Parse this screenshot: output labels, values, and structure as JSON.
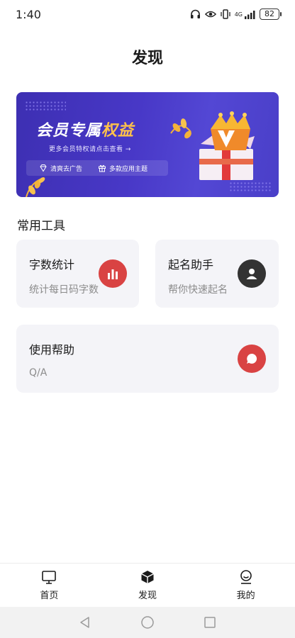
{
  "status": {
    "time": "1:40",
    "network": "4G",
    "battery": "82"
  },
  "page": {
    "title": "发现"
  },
  "banner": {
    "title_main": "会员专属",
    "title_accent": "权益",
    "subtitle": "更多会员特权请点击查看 →",
    "perks": [
      "清爽去广告",
      "多款应用主题"
    ],
    "colors": {
      "background": "#4838c7",
      "accent": "#ffc24a"
    }
  },
  "tools": {
    "section_title": "常用工具",
    "cards": [
      {
        "title": "字数统计",
        "desc": "统计每日码字数",
        "icon": "bar-chart-icon",
        "icon_color": "#d94343"
      },
      {
        "title": "起名助手",
        "desc": "帮你快速起名",
        "icon": "person-icon",
        "icon_color": "#333333"
      },
      {
        "title": "使用帮助",
        "desc": "Q/A",
        "icon": "speech-bubble-icon",
        "icon_color": "#d94343"
      }
    ]
  },
  "bottom_nav": {
    "items": [
      {
        "label": "首页",
        "icon": "monitor-icon"
      },
      {
        "label": "发现",
        "icon": "cube-icon"
      },
      {
        "label": "我的",
        "icon": "user-icon"
      }
    ]
  },
  "system_nav": {
    "icons": [
      "back-triangle-icon",
      "home-circle-icon",
      "recents-square-icon"
    ]
  }
}
